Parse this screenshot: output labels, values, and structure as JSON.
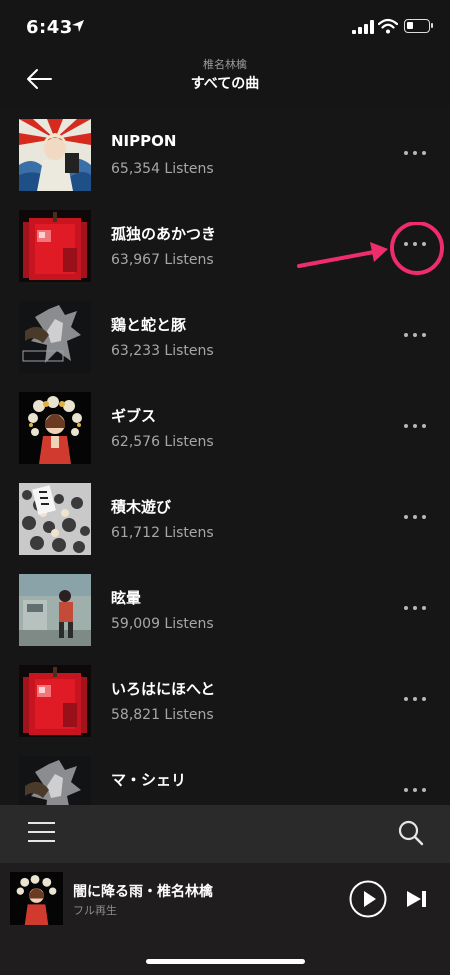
{
  "status_bar": {
    "time": "6:43"
  },
  "header": {
    "artist": "椎名林檎",
    "title": "すべての曲"
  },
  "songs": [
    {
      "title": "NIPPON",
      "listens": "65,354 Listens"
    },
    {
      "title": "孤独のあかつき",
      "listens": "63,967 Listens"
    },
    {
      "title": "鶏と蛇と豚",
      "listens": "63,233 Listens"
    },
    {
      "title": "ギブス",
      "listens": "62,576 Listens"
    },
    {
      "title": "積木遊び",
      "listens": "61,712 Listens"
    },
    {
      "title": "眩暈",
      "listens": "59,009 Listens"
    },
    {
      "title": "いろはにほへと",
      "listens": "58,821 Listens"
    },
    {
      "title": "マ・シェリ",
      "listens": ""
    }
  ],
  "now_playing": {
    "title": "闇に降る雨・椎名林檎",
    "subtitle": "フル再生"
  },
  "icons": {
    "back": "arrow-left-icon",
    "more": "more-horizontal-icon",
    "menu": "hamburger-menu-icon",
    "search": "search-icon",
    "play": "play-icon",
    "next": "skip-next-icon"
  },
  "colors": {
    "annotation": "#ef2c6c",
    "background": "#161616"
  }
}
